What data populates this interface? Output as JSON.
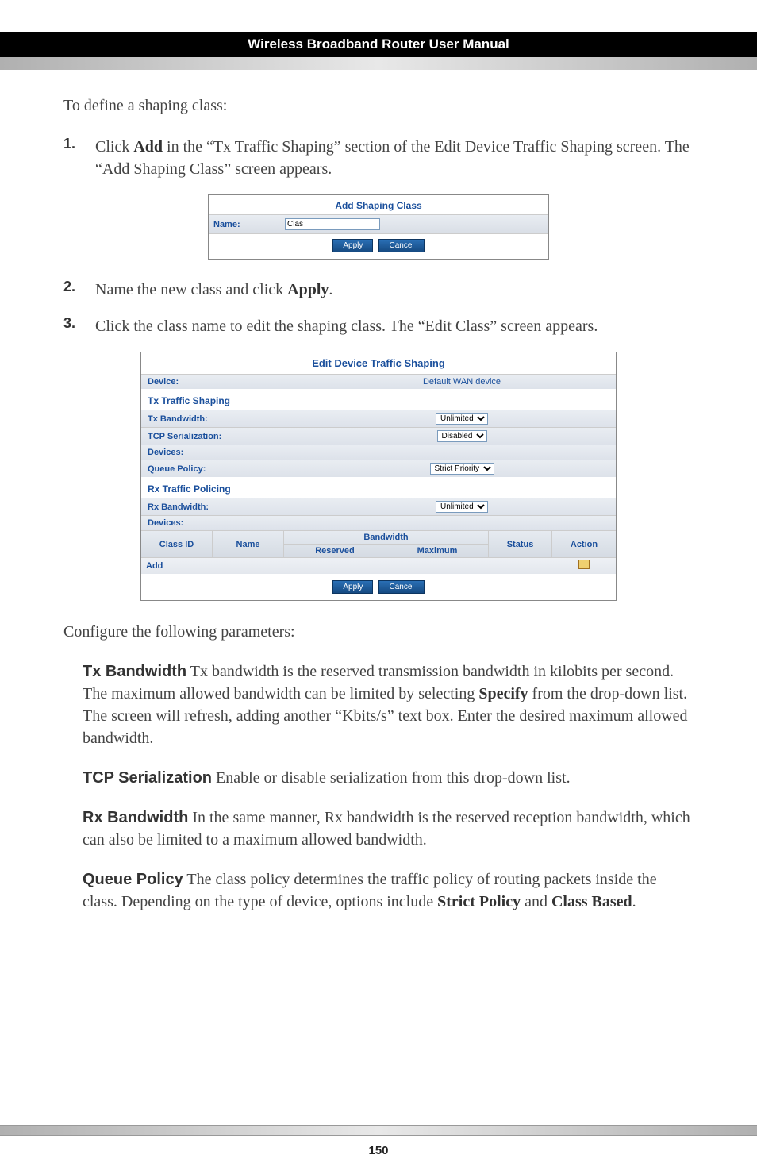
{
  "header": {
    "title": "Wireless Broadband Router User Manual"
  },
  "intro": "To define a shaping class:",
  "steps": {
    "s1": {
      "num": "1.",
      "pre": "Click ",
      "bold1": "Add",
      "post": " in the “Tx Traffic Shaping” section of the Edit Device Traffic Shaping screen. The “Add Shaping Class” screen appears."
    },
    "s2": {
      "num": "2.",
      "pre": "Name the new class and click ",
      "bold1": "Apply",
      "post": "."
    },
    "s3": {
      "num": "3.",
      "text": "Click the class name to edit the shaping class. The “Edit Class” screen appears."
    }
  },
  "asc": {
    "title": "Add Shaping Class",
    "name_label": "Name:",
    "name_value": "Clas",
    "apply": "Apply",
    "cancel": "Cancel"
  },
  "edts": {
    "title": "Edit Device Traffic Shaping",
    "device_label": "Device:",
    "device_value": "Default WAN device",
    "tx_section": "Tx Traffic Shaping",
    "tx_bw_label": "Tx Bandwidth:",
    "tx_bw_value": "Unlimited",
    "tcp_ser_label": "TCP Serialization:",
    "tcp_ser_value": "Disabled",
    "devices_label": "Devices:",
    "queue_label": "Queue Policy:",
    "queue_value": "Strict Priority",
    "rx_section": "Rx Traffic Policing",
    "rx_bw_label": "Rx Bandwidth:",
    "rx_bw_value": "Unlimited",
    "devices_label2": "Devices:",
    "th_classid": "Class ID",
    "th_name": "Name",
    "th_bandwidth": "Bandwidth",
    "th_reserved": "Reserved",
    "th_maximum": "Maximum",
    "th_status": "Status",
    "th_action": "Action",
    "add_label": "Add",
    "apply": "Apply",
    "cancel": "Cancel"
  },
  "params_intro": "Configure the following parameters:",
  "params": {
    "txbw": {
      "title": "Tx Bandwidth",
      "t1": "  Tx bandwidth is the reserved transmission bandwidth in kilobits per second. The maximum allowed bandwidth can be limited by selecting ",
      "b1": "Specify",
      "t2": " from the drop-down list. The screen will refresh, adding another “Kbits/s” text box. Enter the desired maximum allowed bandwidth."
    },
    "tcp": {
      "title": "TCP Serialization",
      "t1": " Enable or disable serialization from this drop-down list."
    },
    "rxbw": {
      "title": "Rx Bandwidth",
      "t1": "  In the same manner, Rx bandwidth is the reserved reception bandwidth, which can also be limited to a maximum allowed bandwidth."
    },
    "queue": {
      "title": "Queue Policy",
      "t1": "  The class policy determines the traffic policy of routing packets inside the class. Depending on the type of device, options include ",
      "b1": "Strict Policy",
      "t2": " and ",
      "b2": "Class Based",
      "t3": "."
    }
  },
  "footer": {
    "page_number": "150"
  }
}
